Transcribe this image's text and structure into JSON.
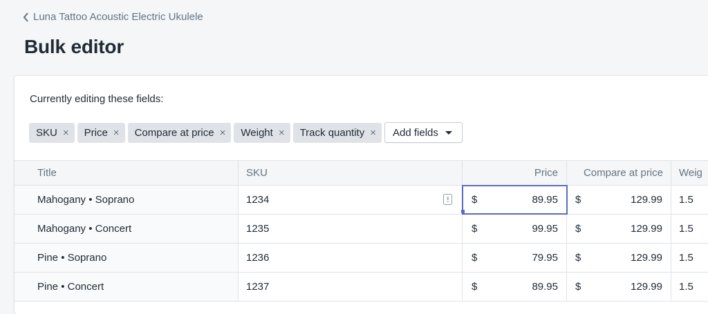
{
  "breadcrumb": {
    "label": "Luna Tattoo Acoustic Electric Ukulele"
  },
  "page": {
    "title": "Bulk editor"
  },
  "editing": {
    "label": "Currently editing these fields:",
    "fields": [
      "SKU",
      "Price",
      "Compare at price",
      "Weight",
      "Track quantity"
    ],
    "remove_glyph": "×",
    "add_fields_label": "Add fields"
  },
  "table": {
    "columns": [
      "Title",
      "SKU",
      "Price",
      "Compare at price",
      "Weig"
    ],
    "currency": "$",
    "rows": [
      {
        "title": "Mahogany • Soprano",
        "sku": "1234",
        "price": "89.95",
        "compare": "129.99",
        "weight": "1.5"
      },
      {
        "title": "Mahogany • Concert",
        "sku": "1235",
        "price": "99.95",
        "compare": "129.99",
        "weight": "1.5"
      },
      {
        "title": "Pine • Soprano",
        "sku": "1236",
        "price": "79.95",
        "compare": "129.99",
        "weight": "1.5"
      },
      {
        "title": "Pine • Concert",
        "sku": "1237",
        "price": "89.95",
        "compare": "129.99",
        "weight": "1.5"
      }
    ]
  },
  "colors": {
    "accent": "#5c6ac4",
    "background": "#f4f6f8",
    "tag": "#dfe3e8"
  }
}
